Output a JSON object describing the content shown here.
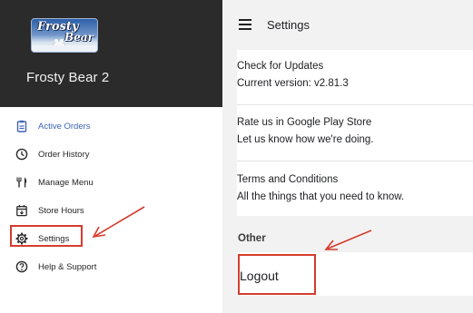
{
  "brand": {
    "logo_line1": "Frosty",
    "logo_line2": "Bear",
    "store_name": "Frosty Bear  2"
  },
  "nav": {
    "items": [
      {
        "label": "Active Orders",
        "icon": "clipboard-icon",
        "active": true
      },
      {
        "label": "Order History",
        "icon": "clock-icon",
        "active": false
      },
      {
        "label": "Manage Menu",
        "icon": "fork-knife-icon",
        "active": false
      },
      {
        "label": "Store Hours",
        "icon": "calendar-icon",
        "active": false
      },
      {
        "label": "Settings",
        "icon": "gear-icon",
        "active": false
      },
      {
        "label": "Help & Support",
        "icon": "help-circle-icon",
        "active": false
      }
    ]
  },
  "header": {
    "menu_icon": "hamburger-icon",
    "title": "Settings"
  },
  "settings": {
    "items": [
      {
        "title": "Check for Updates",
        "subtitle": "Current version: v2.81.3"
      },
      {
        "title": "Rate us in Google Play Store",
        "subtitle": "Let us know how we're doing."
      },
      {
        "title": "Terms and Conditions",
        "subtitle": "All the things that you need to know."
      }
    ],
    "other_section": "Other",
    "logout_label": "Logout"
  },
  "colors": {
    "header_bg": "#2b2b2b",
    "active_nav": "#3f63b5",
    "panel_bg": "#f2f2f2",
    "annotation_red": "#d43c2c"
  }
}
